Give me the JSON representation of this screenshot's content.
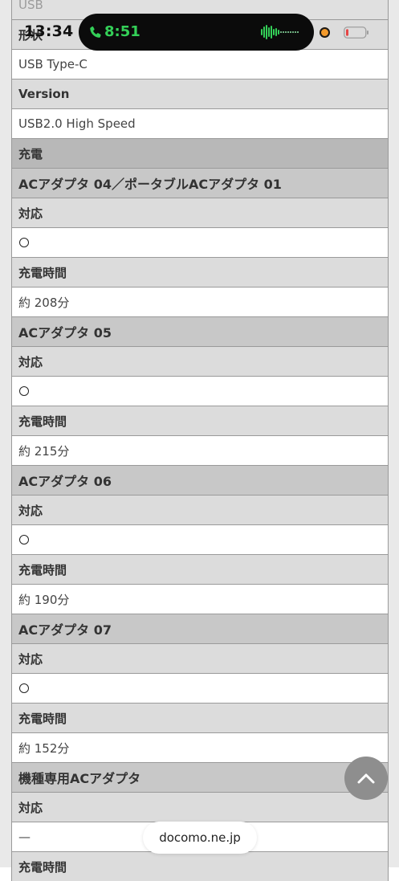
{
  "status_bar": {
    "time": "13:34",
    "call_time": "8:51",
    "accent_call": "#34d058",
    "record_dot_color": "#f39a2b"
  },
  "table_rows": [
    {
      "kind": "faded",
      "text": "USB"
    },
    {
      "kind": "label",
      "text": "形状"
    },
    {
      "kind": "value",
      "text": "USB Type-C"
    },
    {
      "kind": "label",
      "text": "Version"
    },
    {
      "kind": "value",
      "text": "USB2.0 High Speed"
    },
    {
      "kind": "section",
      "text": "充電"
    },
    {
      "kind": "subhead",
      "text": "ACアダプタ 04／ポータブルACアダプタ 01"
    },
    {
      "kind": "label",
      "text": "対応"
    },
    {
      "kind": "mark",
      "text": "○"
    },
    {
      "kind": "label",
      "text": "充電時間"
    },
    {
      "kind": "value",
      "text": "約 208分"
    },
    {
      "kind": "subhead",
      "text": "ACアダプタ 05"
    },
    {
      "kind": "label",
      "text": "対応"
    },
    {
      "kind": "mark",
      "text": "○"
    },
    {
      "kind": "label",
      "text": "充電時間"
    },
    {
      "kind": "value",
      "text": "約 215分"
    },
    {
      "kind": "subhead",
      "text": "ACアダプタ 06"
    },
    {
      "kind": "label",
      "text": "対応"
    },
    {
      "kind": "mark",
      "text": "○"
    },
    {
      "kind": "label",
      "text": "充電時間"
    },
    {
      "kind": "value",
      "text": "約 190分"
    },
    {
      "kind": "subhead",
      "text": "ACアダプタ 07"
    },
    {
      "kind": "label",
      "text": "対応"
    },
    {
      "kind": "mark",
      "text": "○"
    },
    {
      "kind": "label",
      "text": "充電時間"
    },
    {
      "kind": "value",
      "text": "約 152分"
    },
    {
      "kind": "subhead",
      "text": "機種専用ACアダプタ"
    },
    {
      "kind": "label",
      "text": "対応"
    },
    {
      "kind": "value",
      "text": "—"
    },
    {
      "kind": "label",
      "text": "充電時間"
    }
  ],
  "icons": {
    "call": "phone-icon",
    "waveform": "audio-waveform-icon",
    "battery": "battery-low-icon",
    "scroll_top": "chevron-up-icon"
  },
  "browser": {
    "url": "docomo.ne.jp"
  }
}
